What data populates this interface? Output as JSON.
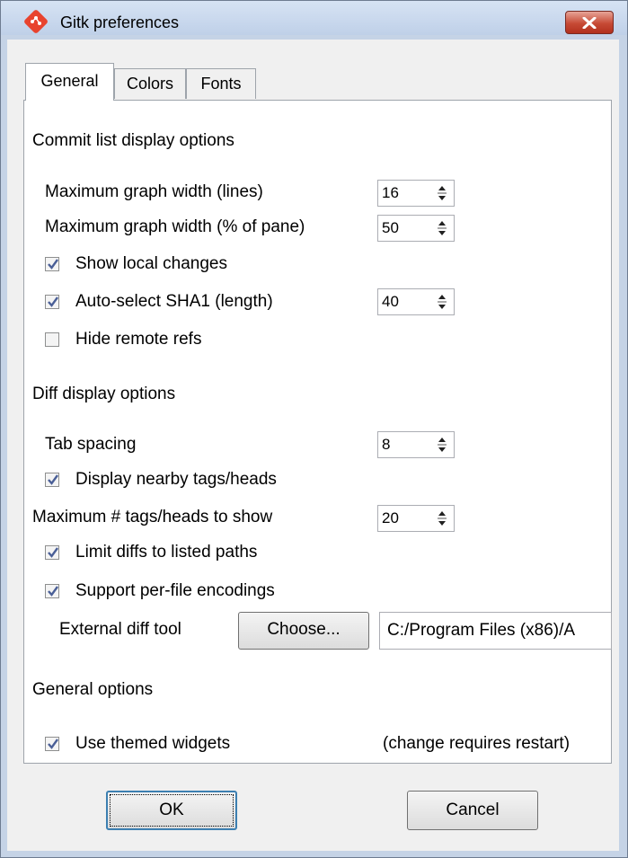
{
  "window": {
    "title": "Gitk preferences"
  },
  "tabs": [
    {
      "label": "General",
      "active": true
    },
    {
      "label": "Colors",
      "active": false
    },
    {
      "label": "Fonts",
      "active": false
    }
  ],
  "commit_list": {
    "heading": "Commit list display options",
    "max_graph_width_lines": {
      "label": "Maximum graph width (lines)",
      "value": "16"
    },
    "max_graph_width_pct": {
      "label": "Maximum graph width (% of pane)",
      "value": "50"
    },
    "show_local_changes": {
      "label": "Show local changes",
      "checked": true
    },
    "auto_select_sha1": {
      "label": "Auto-select SHA1 (length)",
      "checked": true,
      "value": "40"
    },
    "hide_remote_refs": {
      "label": "Hide remote refs",
      "checked": false
    }
  },
  "diff_display": {
    "heading": "Diff display options",
    "tab_spacing": {
      "label": "Tab spacing",
      "value": "8"
    },
    "display_nearby_tags": {
      "label": "Display nearby tags/heads",
      "checked": true
    },
    "max_tags_heads": {
      "label": "Maximum # tags/heads to show",
      "value": "20"
    },
    "limit_diffs": {
      "label": "Limit diffs to listed paths",
      "checked": true
    },
    "per_file_encodings": {
      "label": "Support per-file encodings",
      "checked": true
    },
    "external_diff_tool": {
      "label": "External diff tool",
      "choose_label": "Choose...",
      "path": "C:/Program Files (x86)/A"
    }
  },
  "general_options": {
    "heading": "General options",
    "themed_widgets": {
      "label": "Use themed widgets",
      "checked": true,
      "note": "(change requires restart)"
    }
  },
  "footer": {
    "ok_label": "OK",
    "cancel_label": "Cancel"
  },
  "colors": {
    "close_button": "#c74a35",
    "check_mark": "#4a5f97",
    "app_icon": "#e8432e"
  }
}
